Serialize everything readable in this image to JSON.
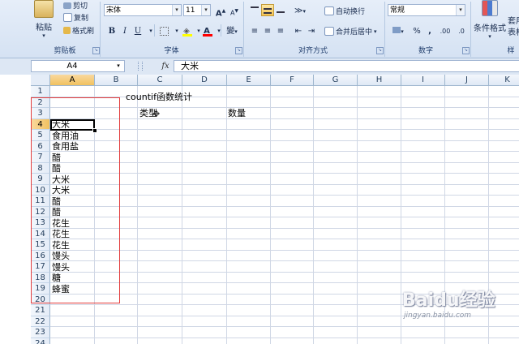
{
  "ribbon": {
    "clipboard": {
      "paste_label": "粘贴",
      "cut_label": "剪切",
      "copy_label": "复制",
      "format_painter_label": "格式刷",
      "group_label": "剪贴板"
    },
    "font": {
      "font_name": "宋体",
      "font_size": "11",
      "bold": "B",
      "italic": "I",
      "underline": "U",
      "grow": "A",
      "shrink": "A",
      "font_color": "A",
      "fill_icon": "paint-bucket-icon",
      "wen": "變",
      "group_label": "字体"
    },
    "alignment": {
      "wrap_text_label": "自动换行",
      "merge_center_label": "合并后居中",
      "group_label": "对齐方式"
    },
    "number": {
      "format_value": "常规",
      "percent": "%",
      "comma": ",",
      "inc_decimal": ".00",
      "dec_decimal": ".0",
      "group_label": "数字"
    },
    "styles": {
      "conditional_format_label": "条件格式",
      "table_format_label": "套用\n表格",
      "group_label": "样"
    },
    "colors": {
      "ribbon_bg": "#dbe5f3",
      "font_color_bar": "#ff0000",
      "fill_color_bar": "#ffff00"
    }
  },
  "formula_bar": {
    "name_box": "A4",
    "fx_label": "fx",
    "content": "大米"
  },
  "sheet": {
    "columns": [
      "A",
      "B",
      "C",
      "D",
      "E",
      "F",
      "G",
      "H",
      "I",
      "J",
      "K"
    ],
    "rows": [
      "1",
      "2",
      "3",
      "4",
      "5",
      "6",
      "7",
      "8",
      "9",
      "10",
      "11",
      "12",
      "13",
      "14",
      "15",
      "16",
      "17",
      "18",
      "19",
      "20",
      "21",
      "22",
      "23",
      "24"
    ],
    "selected_column": "A",
    "selected_row": "4",
    "title_cell": "countif函数统计",
    "header_type": "类型",
    "header_count": "数量",
    "col_a_values": [
      "大米",
      "食用油",
      "食用盐",
      "醋",
      "醋",
      "大米",
      "大米",
      "醋",
      "醋",
      "花生",
      "花生",
      "花生",
      "馒头",
      "馒头",
      "糖",
      "蜂蜜"
    ],
    "highlight_color": "#e23c3c"
  },
  "watermark": {
    "logo": "Baidu经验",
    "sub": "jingyan.baidu.com"
  }
}
